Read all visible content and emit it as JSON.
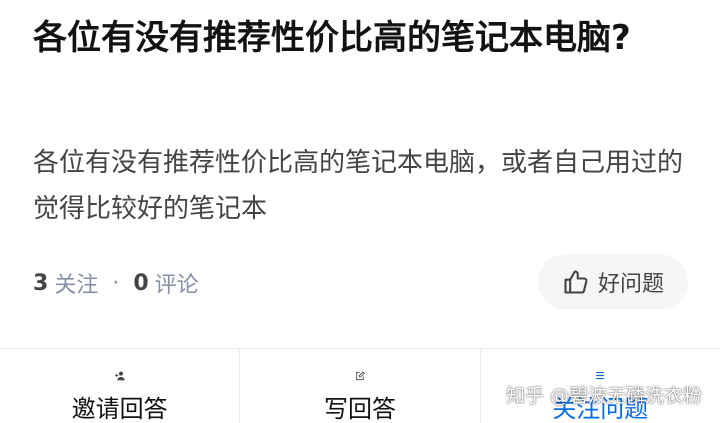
{
  "question": {
    "title": "各位有没有推荐性价比高的笔记本电脑?",
    "detail": "各位有没有推荐性价比高的笔记本电脑，或者自己用过的觉得比较好的笔记本"
  },
  "meta": {
    "follow_count": "3",
    "follow_label": "关注",
    "separator": "·",
    "comment_count": "0",
    "comment_label": "评论"
  },
  "good_question_button": {
    "label": "好问题",
    "icon": "thumbs-up-icon"
  },
  "actions": [
    {
      "label": "邀请回答",
      "icon": "add-user-icon"
    },
    {
      "label": "写回答",
      "icon": "edit-icon"
    },
    {
      "label": "关注问题",
      "icon": "list-icon",
      "color": "#056de8"
    }
  ],
  "watermark": "知乎 @碧波无磷洗衣粉",
  "colors": {
    "accent": "#056de8",
    "text": "#121212",
    "muted": "#8590a6"
  }
}
